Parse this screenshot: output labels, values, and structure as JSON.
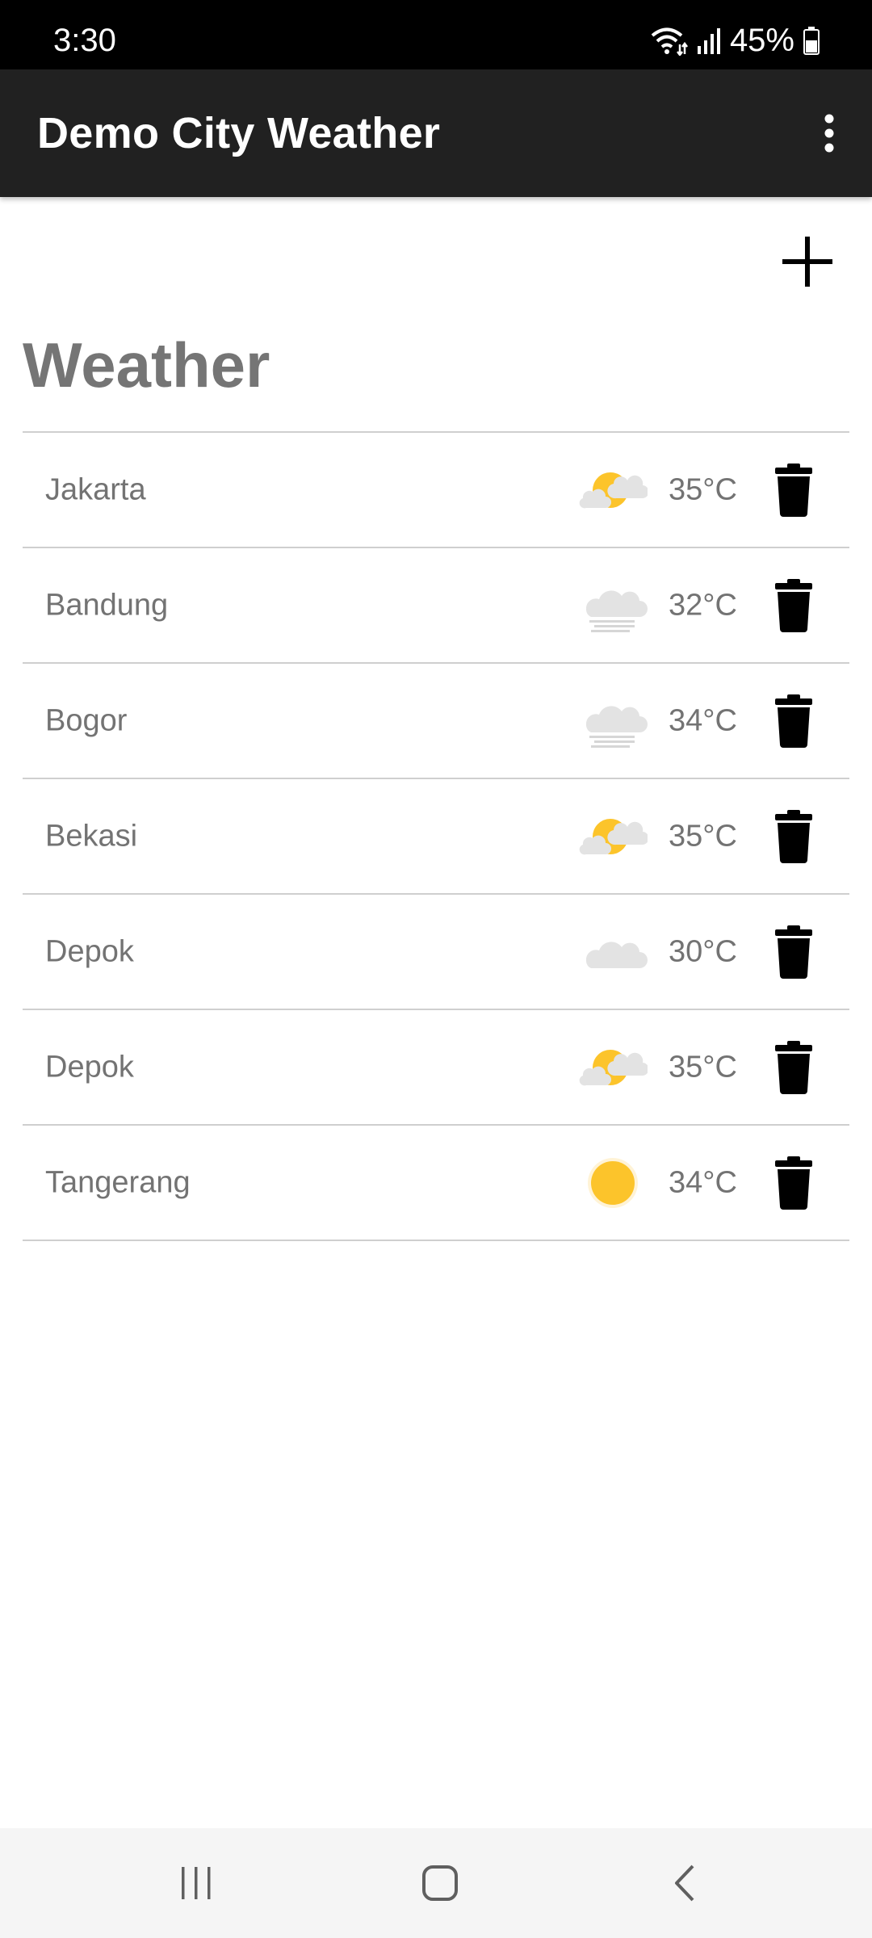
{
  "status_bar": {
    "time": "3:30",
    "battery": "45%",
    "icons": [
      "wifi-icon",
      "signal-icon",
      "battery-icon"
    ]
  },
  "app_bar": {
    "title": "Demo City Weather",
    "menu_icon": "more-vert-icon"
  },
  "content": {
    "add_icon": "plus-icon",
    "section_title": "Weather"
  },
  "cities": [
    {
      "name": "Jakarta",
      "temp": "35°C",
      "icon": "partly-cloudy-icon"
    },
    {
      "name": "Bandung",
      "temp": "32°C",
      "icon": "fog-icon"
    },
    {
      "name": "Bogor",
      "temp": "34°C",
      "icon": "fog-icon"
    },
    {
      "name": "Bekasi",
      "temp": "35°C",
      "icon": "partly-cloudy-icon"
    },
    {
      "name": "Depok",
      "temp": "30°C",
      "icon": "cloud-icon"
    },
    {
      "name": "Depok",
      "temp": "35°C",
      "icon": "partly-cloudy-icon"
    },
    {
      "name": "Tangerang",
      "temp": "34°C",
      "icon": "sun-icon"
    }
  ],
  "colors": {
    "status_bar": "#000000",
    "app_bar": "#212121",
    "text_secondary": "#737373",
    "sun": "#FCC42B",
    "cloud": "#E3E3E3",
    "divider": "#CFCFCF"
  },
  "nav_bar": {
    "icons": [
      "recent-apps-icon",
      "home-icon",
      "back-icon"
    ]
  }
}
